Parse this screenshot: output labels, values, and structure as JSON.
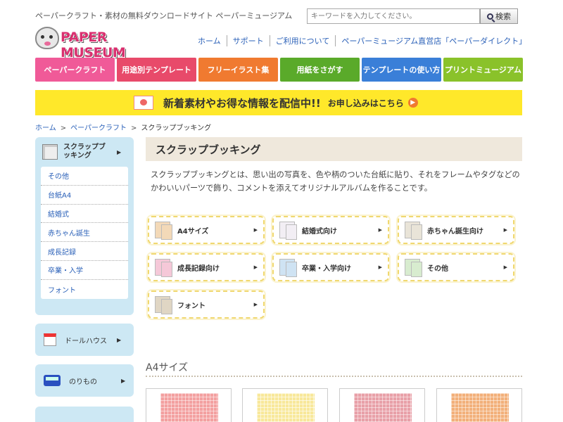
{
  "header": {
    "tagline": "ペーパークラフト・素材の無料ダウンロードサイト ペーパーミュージアム",
    "search_placeholder": "キーワードを入力してください。",
    "search_button": "検索",
    "logo_text": "PAPER MUSEUM",
    "top_links": [
      "ホーム",
      "サポート",
      "ご利用について",
      "ペーパーミュージアム直営店「ペーパーダイレクト」"
    ]
  },
  "categories": [
    "ペーパークラフト",
    "用途別テンプレート",
    "フリーイラスト集",
    "用紙をさがす",
    "テンプレートの使い方",
    "プリントミュージアム"
  ],
  "banner": {
    "main": "新着素材やお得な情報を配信中!!",
    "sub": "お申し込みはこちら"
  },
  "breadcrumb": [
    "ホーム",
    "ペーパークラフト",
    "スクラップブッキング"
  ],
  "sidebar": {
    "main_label": "スクラップブッキング",
    "items": [
      "その他",
      "台紙A4",
      "結婚式",
      "赤ちゃん誕生",
      "成長記録",
      "卒業・入学",
      "フォント"
    ],
    "other_sections": [
      "ドールハウス",
      "のりもの"
    ]
  },
  "main": {
    "title": "スクラップブッキング",
    "description": "スクラップブッキングとは、思い出の写真を、色や柄のついた台紙に貼り、それをフレームやタグなどのかわいいパーツで飾り、コメントを添えてオリジナルアルバムを作ることです。",
    "tiles": [
      "A4サイズ",
      "結婚式向け",
      "赤ちゃん誕生向け",
      "成長記録向け",
      "卒業・入学向け",
      "その他",
      "フォント"
    ],
    "section_title": "A4サイズ"
  }
}
